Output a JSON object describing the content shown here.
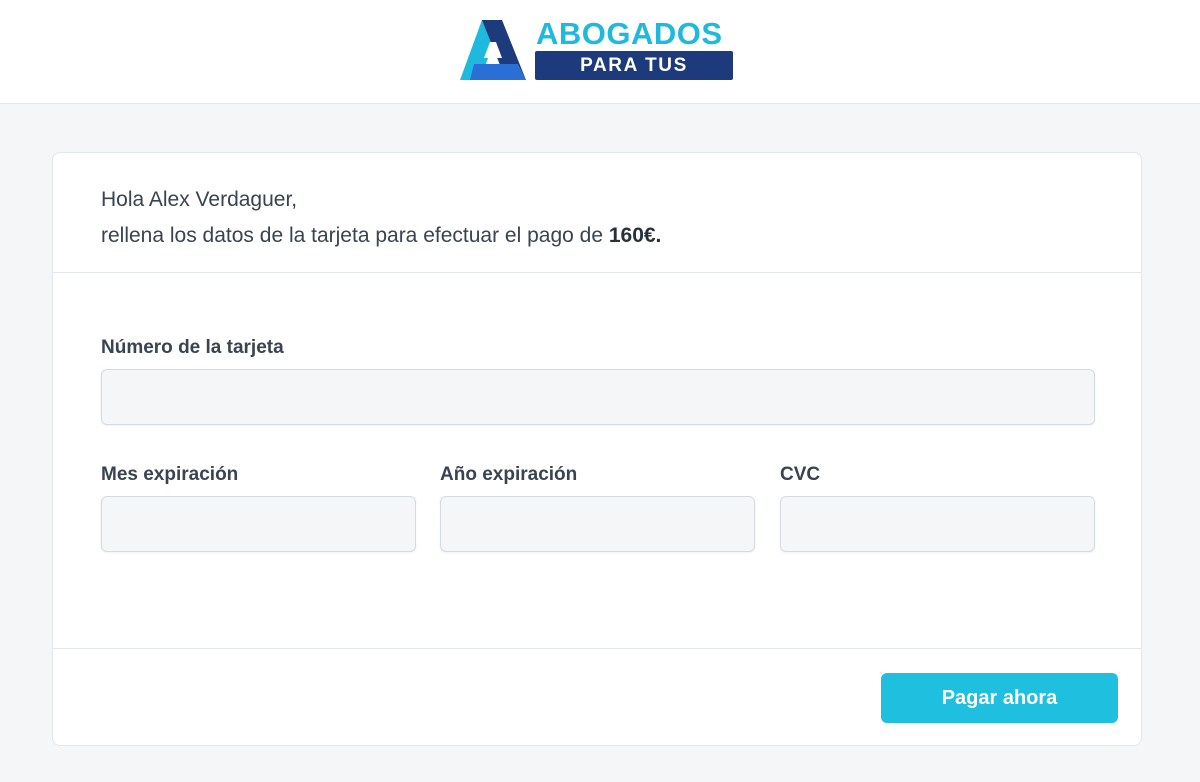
{
  "brand": {
    "name_top": "ABOGADOS",
    "name_bottom": "PARA TUS DEUDAS",
    "colors": {
      "cyan": "#1fb9de",
      "navy": "#1c3a7c",
      "blue": "#2a6fd6"
    }
  },
  "payment": {
    "greeting_line1": "Hola Alex Verdaguer,",
    "greeting_line2_prefix": "rellena los datos de la tarjeta para efectuar el pago de ",
    "amount": "160€."
  },
  "form": {
    "card_number_label": "Número de la tarjeta",
    "card_number_value": "",
    "exp_month_label": "Mes expiración",
    "exp_month_value": "",
    "exp_year_label": "Año expiración",
    "exp_year_value": "",
    "cvc_label": "CVC",
    "cvc_value": ""
  },
  "actions": {
    "pay_label": "Pagar ahora",
    "pay_color": "#1fbfdf"
  }
}
